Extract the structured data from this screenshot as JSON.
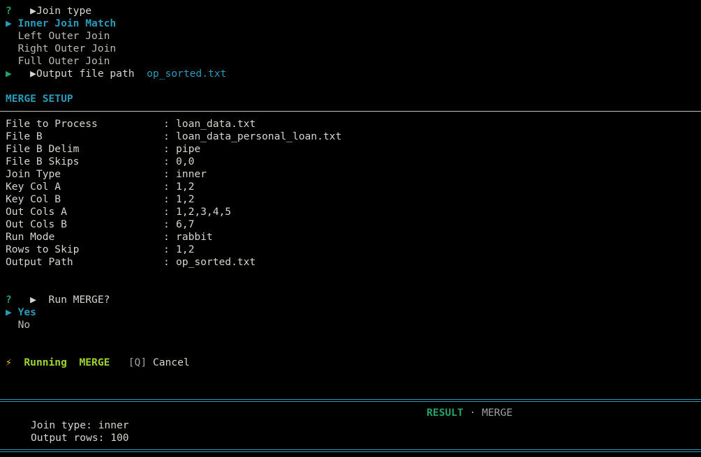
{
  "prompt1": {
    "question_mark": "?",
    "label": "Join type",
    "options": [
      {
        "label": "Inner Join Match",
        "selected": true
      },
      {
        "label": "Left Outer Join",
        "selected": false
      },
      {
        "label": "Right Outer Join",
        "selected": false
      },
      {
        "label": "Full Outer Join",
        "selected": false
      }
    ]
  },
  "prompt2": {
    "label": "Output file path",
    "value": "op_sorted.txt"
  },
  "merge_setup": {
    "title": "MERGE SETUP",
    "rows": [
      {
        "key": "File to Process",
        "value": "loan_data.txt"
      },
      {
        "key": "File B",
        "value": "loan_data_personal_loan.txt"
      },
      {
        "key": "File B Delim",
        "value": "pipe"
      },
      {
        "key": "File B Skips",
        "value": "0,0"
      },
      {
        "key": "Join Type",
        "value": "inner"
      },
      {
        "key": "Key Col A",
        "value": "1,2"
      },
      {
        "key": "Key Col B",
        "value": "1,2"
      },
      {
        "key": "Out Cols A",
        "value": "1,2,3,4,5"
      },
      {
        "key": "Out Cols B",
        "value": "6,7"
      },
      {
        "key": "Run Mode",
        "value": "rabbit"
      },
      {
        "key": "Rows to Skip",
        "value": "1,2"
      },
      {
        "key": "Output Path",
        "value": "op_sorted.txt"
      }
    ],
    "separator": ":"
  },
  "prompt3": {
    "question_mark": "?",
    "label": "Run MERGE?",
    "options": [
      {
        "label": "Yes",
        "selected": true
      },
      {
        "label": "No",
        "selected": false
      }
    ]
  },
  "running": {
    "status": "Running",
    "name": "MERGE",
    "cancel_key": "[Q]",
    "cancel_label": "Cancel"
  },
  "result": {
    "title": "RESULT",
    "dot": "·",
    "name": "MERGE",
    "lines": [
      "Join type: inner",
      "Output rows: 100"
    ]
  },
  "colors": {
    "background": "#000000",
    "text": "#d3d7cf",
    "accent_teal": "#2a9bb8",
    "green": "#26a269",
    "lime": "#9fd52a",
    "bolt": "#f5c211"
  },
  "icons": {
    "pointer": "▶",
    "bolt": "⚡"
  }
}
